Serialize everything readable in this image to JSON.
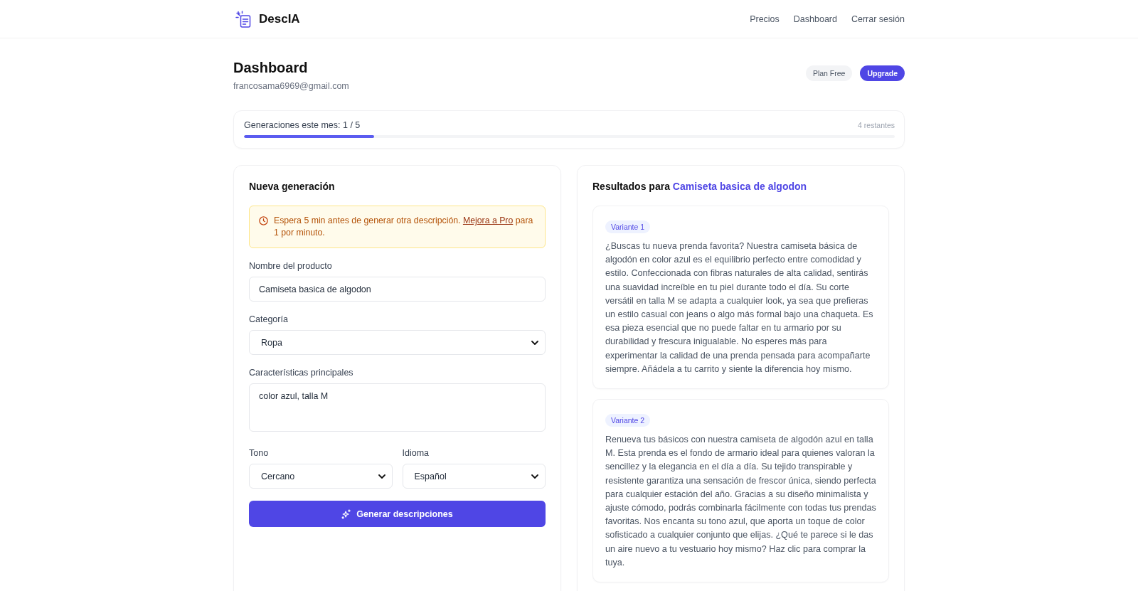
{
  "header": {
    "logo_text": "DescIA",
    "nav": [
      {
        "label": "Precios"
      },
      {
        "label": "Dashboard"
      },
      {
        "label": "Cerrar sesión"
      }
    ]
  },
  "page": {
    "title": "Dashboard",
    "email": "francosama6969@gmail.com",
    "plan_badge": "Plan Free",
    "upgrade_button": "Upgrade"
  },
  "usage": {
    "label": "Generaciones este mes: 1 / 5",
    "remaining": "4 restantes",
    "level": 0.2
  },
  "form": {
    "title": "Nueva generación",
    "notice": {
      "text": "Espera 5 min antes de generar otra descripción.",
      "link": "Mejora a Pro",
      "text_after": "para 1 por minuto."
    },
    "fields": [
      {
        "kind": "text",
        "label": "Nombre del producto",
        "value": "Camiseta basica de algodon"
      },
      {
        "kind": "select",
        "label": "Categoría",
        "value": "Ropa"
      },
      {
        "kind": "textarea",
        "label": "Características principales",
        "value": "color azul, talla M"
      }
    ],
    "paired_fields": [
      {
        "kind": "select",
        "label": "Tono",
        "value": "Cercano"
      },
      {
        "kind": "select",
        "label": "Idioma",
        "value": "Español"
      }
    ],
    "submit_button": "Generar descripciones"
  },
  "results": {
    "title": "Resultados para",
    "product": "Camiseta basica de algodon",
    "variants": [
      {
        "badge": "Variante 1",
        "text": "¿Buscas tu nueva prenda favorita? Nuestra camiseta básica de algodón en color azul es el equilibrio perfecto entre comodidad y estilo. Confeccionada con fibras naturales de alta calidad, sentirás una suavidad increíble en tu piel durante todo el día. Su corte versátil en talla M se adapta a cualquier look, ya sea que prefieras un estilo casual con jeans o algo más formal bajo una chaqueta. Es esa pieza esencial que no puede faltar en tu armario por su durabilidad y frescura inigualable. No esperes más para experimentar la calidad de una prenda pensada para acompañarte siempre. Añádela a tu carrito y siente la diferencia hoy mismo."
      },
      {
        "badge": "Variante 2",
        "text": "Renueva tus básicos con nuestra camiseta de algodón azul en talla M. Esta prenda es el fondo de armario ideal para quienes valoran la sencillez y la elegancia en el día a día. Su tejido transpirable y resistente garantiza una sensación de frescor única, siendo perfecta para cualquier estación del año. Gracias a su diseño minimalista y ajuste cómodo, podrás combinarla fácilmente con todas tus prendas favoritas. Nos encanta su tono azul, que aporta un toque de color sofisticado a cualquier conjunto que elijas. ¿Qué te parece si le das un aire nuevo a tu vestuario hoy mismo? Haz clic para comprar la tuya."
      }
    ]
  }
}
